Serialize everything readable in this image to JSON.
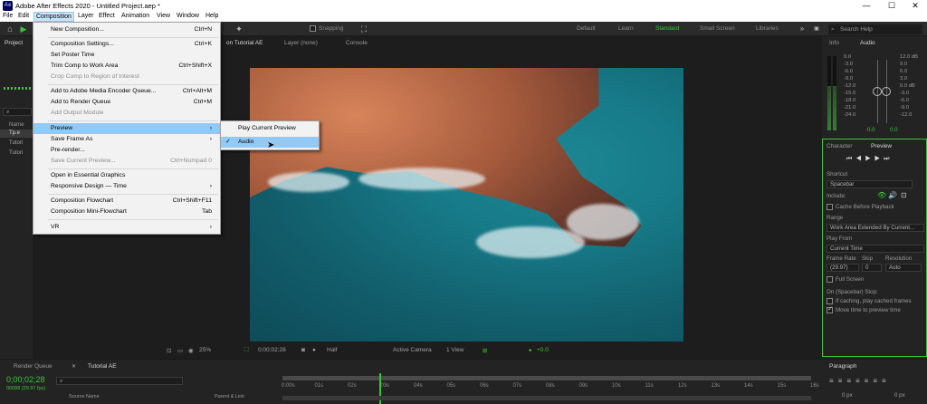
{
  "window": {
    "title": "Adobe After Effects 2020 - Untitled Project.aep *",
    "app_badge": "Ae",
    "minimize": "—",
    "maximize": "☐",
    "close": "✕"
  },
  "menubar": [
    "File",
    "Edit",
    "Composition",
    "Layer",
    "Effect",
    "Animation",
    "View",
    "Window",
    "Help"
  ],
  "toolbar": {
    "snapping": "Snapping",
    "workspaces": [
      "Default",
      "Learn",
      "Standard",
      "Small Screen",
      "Libraries"
    ],
    "active_workspace": "Standard",
    "search_placeholder": "Search Help"
  },
  "composition_menu": [
    {
      "label": "New Composition...",
      "shortcut": "Ctrl+N",
      "disabled": false
    },
    {
      "label": "Composition Settings...",
      "shortcut": "Ctrl+K",
      "disabled": false
    },
    {
      "label": "Set Poster Time",
      "shortcut": "",
      "disabled": false
    },
    {
      "label": "Trim Comp to Work Area",
      "shortcut": "Ctrl+Shift+X",
      "disabled": false
    },
    {
      "label": "Crop Comp to Region of Interest",
      "shortcut": "",
      "disabled": true
    },
    {
      "label": "Add to Adobe Media Encoder Queue...",
      "shortcut": "Ctrl+Alt+M",
      "disabled": false
    },
    {
      "label": "Add to Render Queue",
      "shortcut": "Ctrl+M",
      "disabled": false
    },
    {
      "label": "Add Output Module",
      "shortcut": "",
      "disabled": true
    },
    {
      "label": "Preview",
      "shortcut": "›",
      "disabled": false
    },
    {
      "label": "Save Frame As",
      "shortcut": "›",
      "disabled": false
    },
    {
      "label": "Pre-render...",
      "shortcut": "",
      "disabled": false
    },
    {
      "label": "Save Current Preview...",
      "shortcut": "Ctrl+Numpad 0",
      "disabled": true
    },
    {
      "label": "Open in Essential Graphics",
      "shortcut": "",
      "disabled": false
    },
    {
      "label": "Responsive Design — Time",
      "shortcut": "›",
      "disabled": false
    },
    {
      "label": "Composition Flowchart",
      "shortcut": "Ctrl+Shift+F11",
      "disabled": false
    },
    {
      "label": "Composition Mini-Flowchart",
      "shortcut": "Tab",
      "disabled": false
    },
    {
      "label": "VR",
      "shortcut": "›",
      "disabled": false
    }
  ],
  "preview_submenu": [
    {
      "label": "Play Current Preview",
      "checked": false
    },
    {
      "label": "Audio",
      "checked": true
    }
  ],
  "project_panel": {
    "tab": "Project",
    "col_name": "Name",
    "items": [
      "Tp.e",
      "Tutori",
      "Tutori"
    ],
    "bpc": "8 bpc"
  },
  "comp_tabs": {
    "composition": "on Tutorial AE",
    "layer": "Layer  (none)",
    "console": "Console"
  },
  "viewer_bar": {
    "zoom": "25%",
    "timecode": "0;00;02;28",
    "resolution": "Half",
    "camera": "Active Camera",
    "views": "1 View",
    "exposure": "+0.0"
  },
  "timeline": {
    "render_queue": "Render Queue",
    "comp_tab": "Tutorial AE",
    "timecode": "0;00;02;28",
    "fps": "00088 (29.97 fps)",
    "source_name": "Source Name",
    "parent": "Parent & Link",
    "ruler": [
      "0:00s",
      "01s",
      "02s",
      "03s",
      "04s",
      "05s",
      "06s",
      "07s",
      "08s",
      "09s",
      "10s",
      "11s",
      "12s",
      "13s",
      "14s",
      "15s",
      "16s"
    ]
  },
  "info_audio": {
    "tabs": [
      "Info",
      "Audio"
    ],
    "db_left": [
      "0.0",
      "-3.0",
      "-6.0",
      "-9.0",
      "-12.0",
      "-15.0",
      "-18.0",
      "-21.0",
      "-24.0"
    ],
    "db_right": [
      "12.0 dB",
      "9.0",
      "6.0",
      "3.0",
      "0.0 dB",
      "-3.0",
      "-6.0",
      "-9.0",
      "-12.0"
    ],
    "levels": [
      "0.0",
      "0.0"
    ]
  },
  "preview_panel": {
    "tabs": [
      "Character",
      "Preview"
    ],
    "shortcut_label": "Shortcut",
    "shortcut_value": "Spacebar",
    "include_label": "Include:",
    "cache_before": "Cache Before Playback",
    "range_label": "Range",
    "range_value": "Work Area Extended By Current...",
    "play_from_label": "Play From",
    "play_from_value": "Current Time",
    "frame_rate_label": "Frame Rate",
    "frame_rate_value": "(29.97)",
    "skip_label": "Skip",
    "skip_value": "0",
    "resolution_label": "Resolution",
    "resolution_value": "Auto",
    "full_screen": "Full Screen",
    "on_stop": "On (Spacebar) Stop:",
    "if_caching": "If caching, play cached frames",
    "move_time": "Move time to preview time"
  },
  "paragraph_panel": {
    "tab": "Paragraph",
    "values": [
      "0 px",
      "0 px",
      "0 px",
      "0 px"
    ]
  },
  "colors": {
    "accent_green": "#3ec23e",
    "menu_highlight": "#91c9f7"
  }
}
